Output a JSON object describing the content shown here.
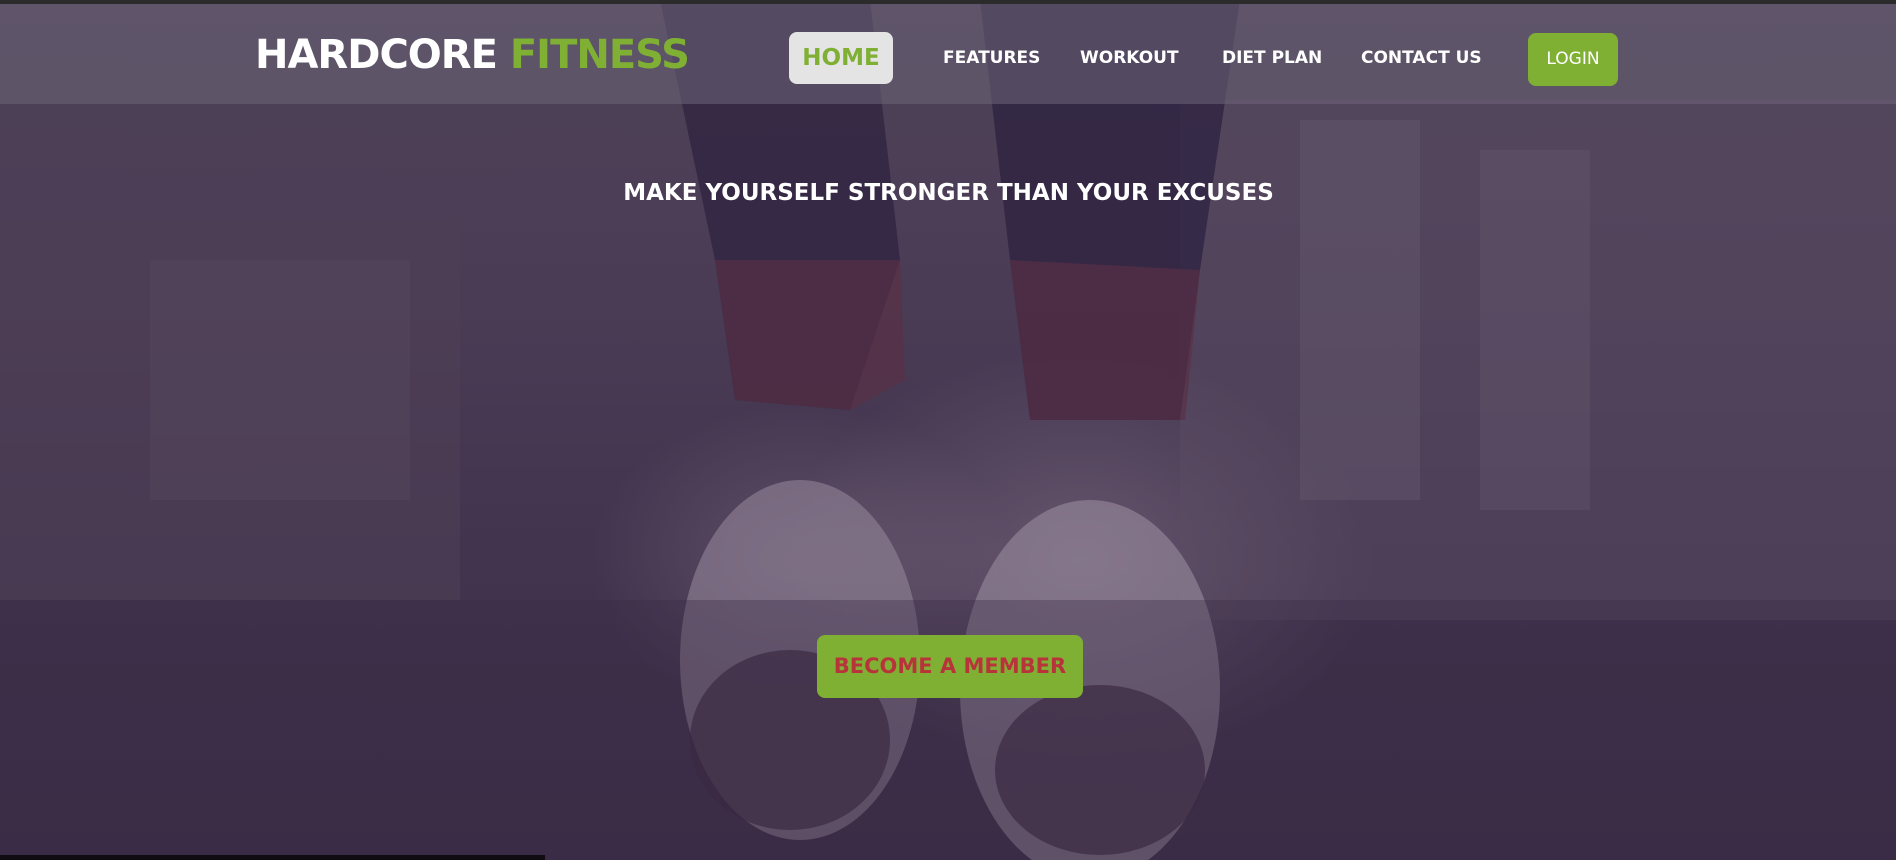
{
  "brand": {
    "name_primary": "HARDCORE",
    "name_accent": "FITNESS"
  },
  "nav": {
    "items": [
      {
        "label": "HOME",
        "active": true
      },
      {
        "label": "FEATURES"
      },
      {
        "label": "WORKOUT"
      },
      {
        "label": "DIET PLAN"
      },
      {
        "label": "CONTACT US"
      }
    ],
    "login_label": "LOGIN"
  },
  "hero": {
    "headline": "MAKE YOURSELF STRONGER THAN YOUR EXCUSES",
    "cta_label": "BECOME A MEMBER",
    "background_image": "running-shoes-street-photo"
  },
  "colors": {
    "accent_green": "#7fb034",
    "cta_text_red": "#b8343b",
    "overlay_purple": "#43354f",
    "active_tab_bg": "#e4e4e4"
  }
}
